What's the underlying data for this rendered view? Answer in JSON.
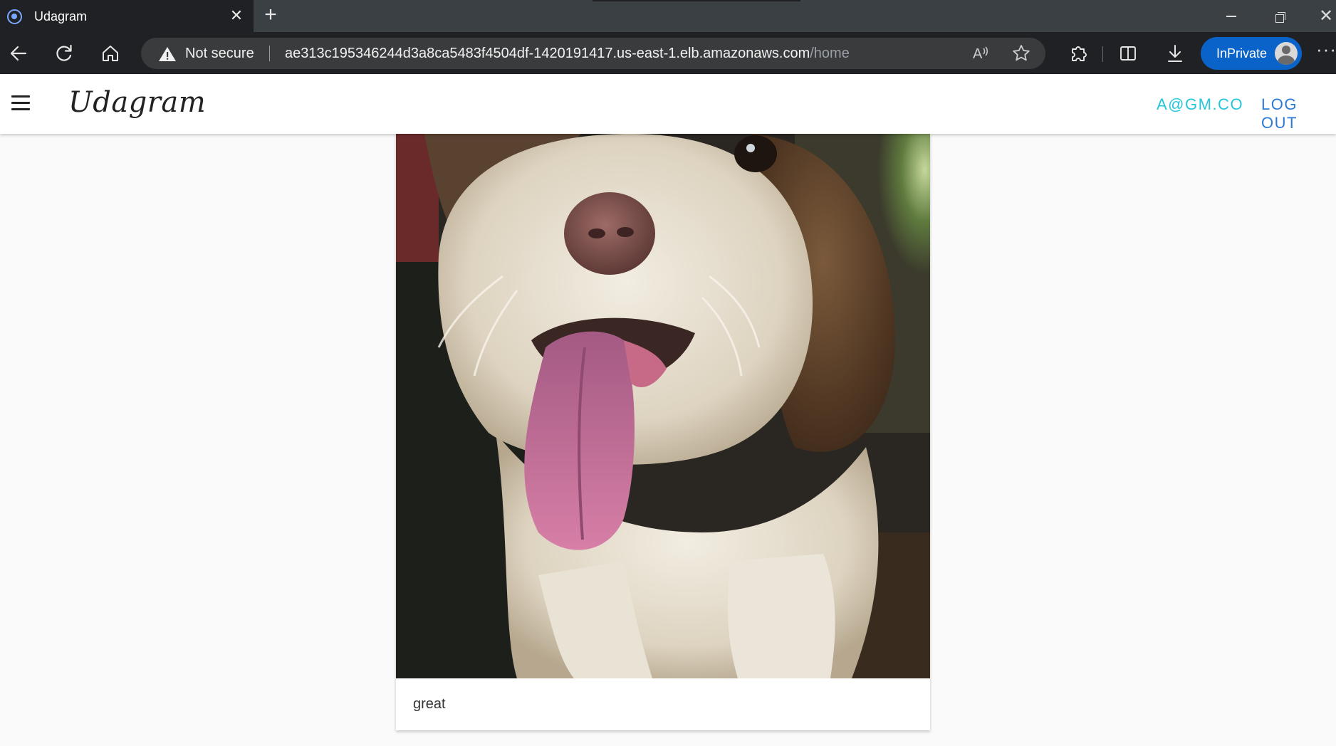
{
  "browser": {
    "tab_title": "Udagram",
    "security_label": "Not secure",
    "url_host": "ae313c195346244d3a8ca5483f4504df-1420191417.us-east-1.elb.amazonaws.com",
    "url_path": "/home",
    "inprivate_label": "InPrivate"
  },
  "app": {
    "brand": "Udagram",
    "user_email": "A@GM.CO",
    "logout_label": "LOG OUT"
  },
  "feed": [
    {
      "caption": "great",
      "image": "photo of a white and brown fluffy dog with tongue out"
    }
  ],
  "colors": {
    "accent_user": "#26c6da",
    "accent_logout": "#2b7bd6",
    "inprivate_badge": "#0a63c9"
  },
  "icons": [
    "back-icon",
    "refresh-icon",
    "home-icon",
    "warning-icon",
    "read-aloud-icon",
    "favorite-icon",
    "extensions-icon",
    "split-screen-icon",
    "download-icon",
    "menu-icon"
  ]
}
